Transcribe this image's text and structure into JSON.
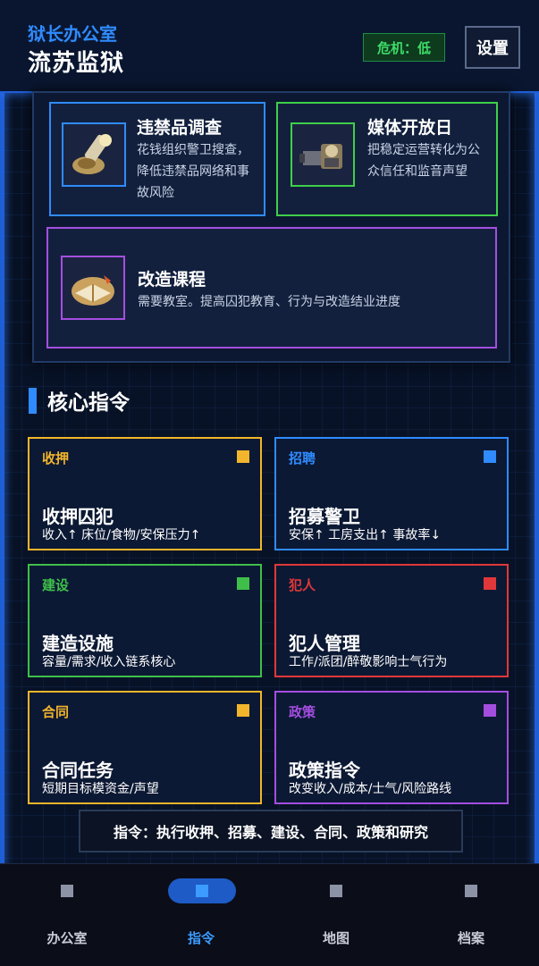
{
  "header": {
    "office_label": "狱长办公室",
    "prison_name": "流苏监狱",
    "danger": "危机：低",
    "settings": "设置"
  },
  "research": [
    {
      "title": "违禁品调查",
      "desc": "花钱组织警卫搜查，降低违禁品网络和事故风险",
      "icon": "flashlight-icon",
      "color": "#2f8bff"
    },
    {
      "title": "媒体开放日",
      "desc": "把稳定运营转化为公众信任和监音声望",
      "icon": "camera-icon",
      "color": "#3fcf4a"
    },
    {
      "title": "改造课程",
      "desc": "需要教室。提高囚犯教育、行为与改造结业进度",
      "icon": "book-icon",
      "color": "#a44ee0"
    }
  ],
  "section_title": "核心指令",
  "commands": [
    {
      "cat": "收押",
      "title": "收押囚犯",
      "desc": "收入↑ 床位/食物/安保压力↑",
      "color": "#f2b52b"
    },
    {
      "cat": "招聘",
      "title": "招募警卫",
      "desc": "安保↑ 工房支出↑ 事故率↓",
      "color": "#2f8bff"
    },
    {
      "cat": "建设",
      "title": "建造设施",
      "desc": "容量/需求/收入链系核心",
      "color": "#3fbf4a"
    },
    {
      "cat": "犯人",
      "title": "犯人管理",
      "desc": "工作/派团/醉敬影响士气行为",
      "color": "#e0383a"
    },
    {
      "cat": "合同",
      "title": "合同任务",
      "desc": "短期目标模资金/声望",
      "color": "#f2b52b"
    },
    {
      "cat": "政策",
      "title": "政策指令",
      "desc": "改变收入/成本/士气/风险路线",
      "color": "#a44ee0"
    }
  ],
  "hint": "指令：执行收押、招募、建设、合同、政策和研究",
  "nav": [
    {
      "label": "办公室",
      "active": false
    },
    {
      "label": "指令",
      "active": true
    },
    {
      "label": "地图",
      "active": false
    },
    {
      "label": "档案",
      "active": false
    }
  ]
}
